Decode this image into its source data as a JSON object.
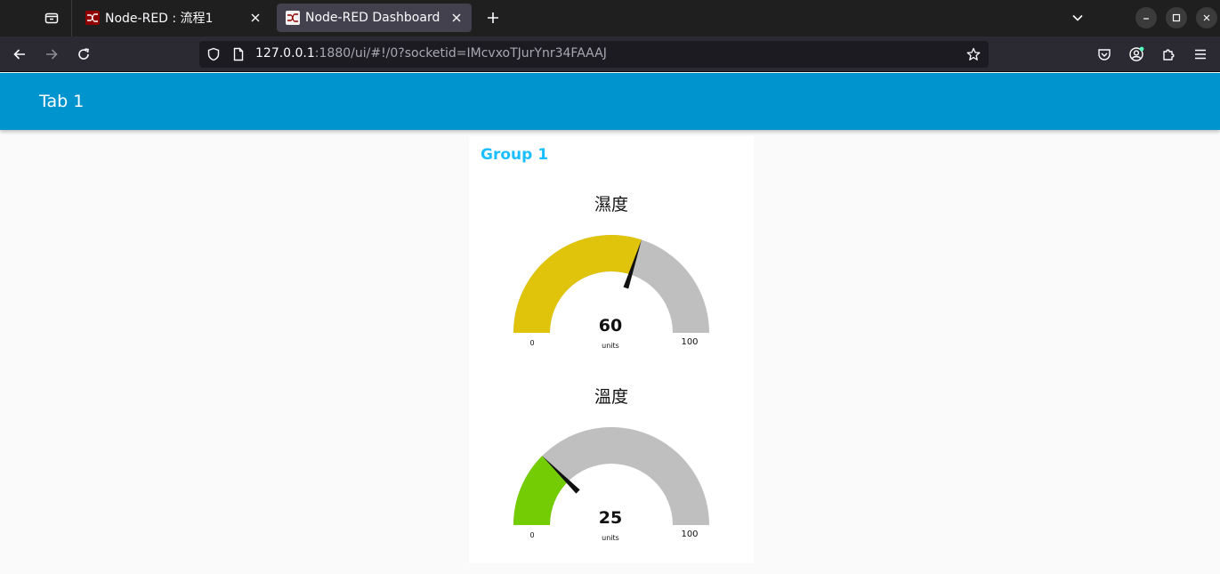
{
  "browser": {
    "tabs": [
      {
        "title": "Node-RED : 流程1",
        "active": false
      },
      {
        "title": "Node-RED Dashboard",
        "active": true
      }
    ],
    "url": {
      "host": "127.0.0.1",
      "rest": ":1880/ui/#!/0?socketid=IMcvxoTJurYnr34FAAAJ"
    },
    "colors": {
      "tabstrip": "#1f1f1f",
      "toolbar": "#2b2a33",
      "accent_dot": "#54ffbd"
    }
  },
  "dashboard": {
    "tab_title": "Tab 1",
    "header_color": "#0094ce",
    "group": {
      "title": "Group 1",
      "title_color": "#1bbfff",
      "gauges": [
        {
          "title": "濕度",
          "value": 60,
          "value_text": "60",
          "units": "units",
          "min": 0,
          "max": 100,
          "min_text": "0",
          "max_text": "100",
          "fill_color": "#e0c30b",
          "track_color": "#bfbfbf"
        },
        {
          "title": "溫度",
          "value": 25,
          "value_text": "25",
          "units": "units",
          "min": 0,
          "max": 100,
          "min_text": "0",
          "max_text": "100",
          "fill_color": "#73cc04",
          "track_color": "#bfbfbf"
        }
      ]
    }
  }
}
